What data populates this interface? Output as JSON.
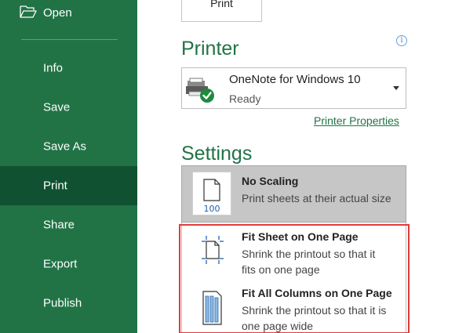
{
  "sidebar": {
    "open_label": "Open",
    "items": [
      {
        "label": "Info"
      },
      {
        "label": "Save"
      },
      {
        "label": "Save As"
      },
      {
        "label": "Print"
      },
      {
        "label": "Share"
      },
      {
        "label": "Export"
      },
      {
        "label": "Publish"
      }
    ],
    "active_item": "Print"
  },
  "print_button": {
    "label": "Print"
  },
  "printer": {
    "heading": "Printer",
    "name": "OneNote for Windows 10",
    "status": "Ready",
    "properties_link": "Printer Properties",
    "info_icon": "info-icon"
  },
  "settings": {
    "heading": "Settings",
    "selected": {
      "title": "No Scaling",
      "description": "Print sheets at their actual size",
      "icon": "page-100-icon",
      "icon_text": "100"
    },
    "options": [
      {
        "title": "Fit Sheet on One Page",
        "description_line1": "Shrink the printout so that it",
        "description_line2": "fits on one page",
        "icon": "fit-sheet-icon"
      },
      {
        "title": "Fit All Columns on One Page",
        "description_line1": "Shrink the printout so that it is",
        "description_line2": "one page wide",
        "icon": "fit-columns-icon"
      }
    ]
  },
  "colors": {
    "sidebar": "#217346",
    "sidebar_active": "#0f5130",
    "accent": "#217346",
    "highlight_border": "#e03c3c"
  }
}
